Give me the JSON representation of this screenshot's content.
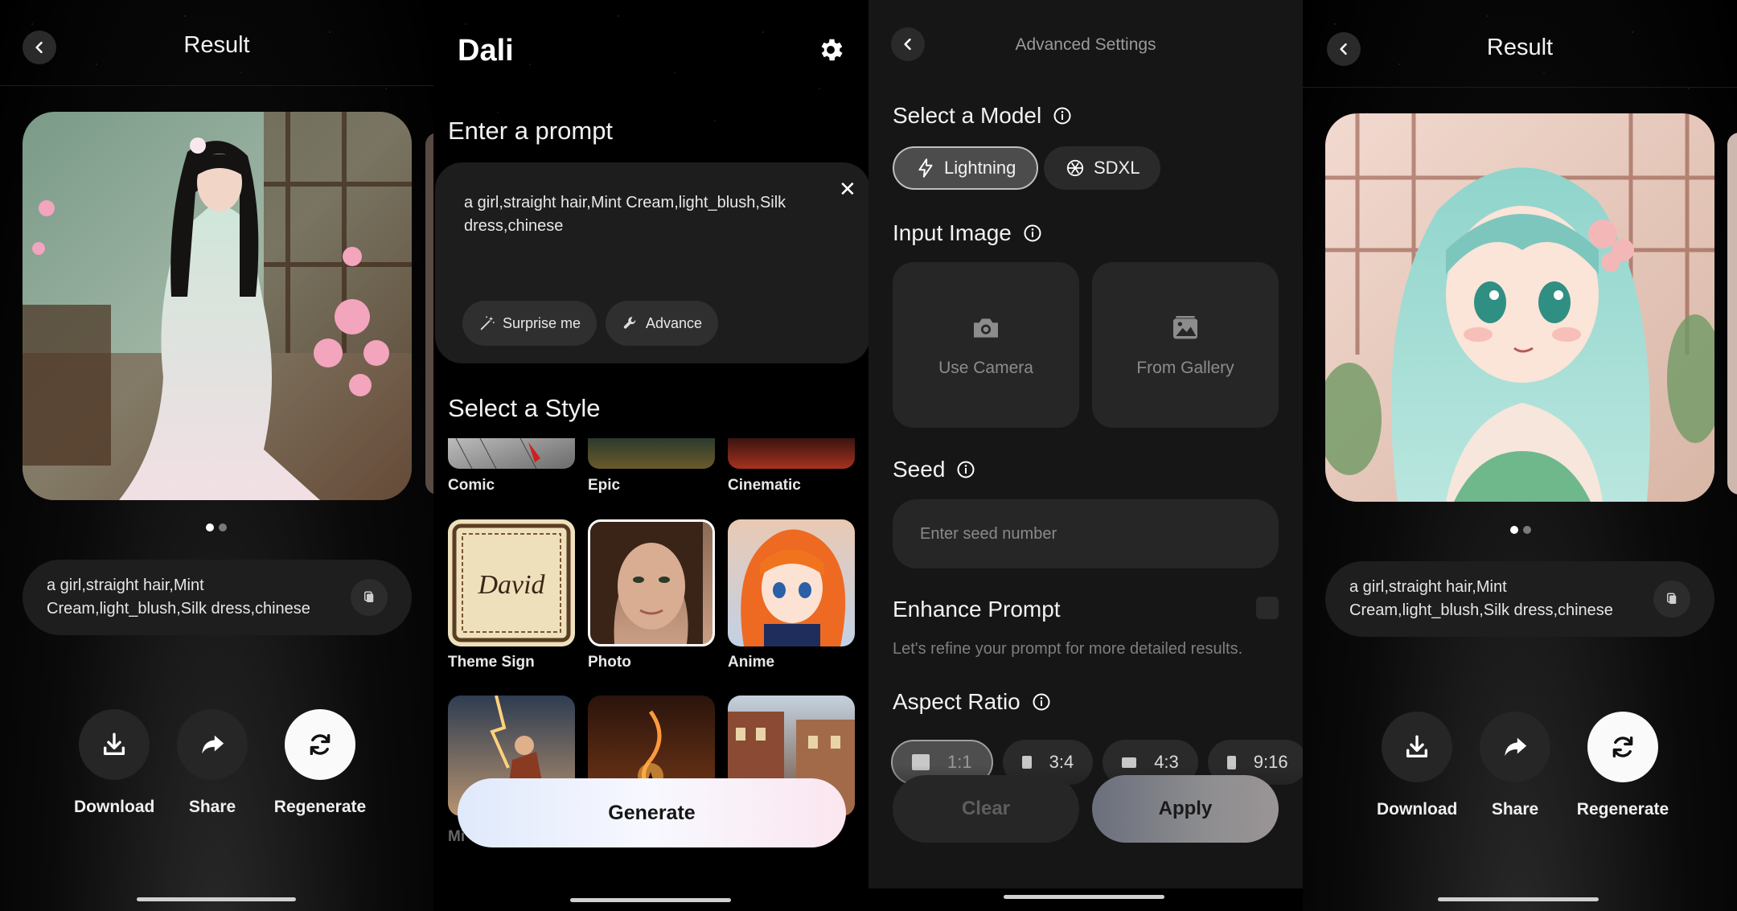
{
  "result_left": {
    "title": "Result",
    "prompt": "a girl,straight hair,Mint Cream,light_blush,Silk dress,chinese",
    "actions": {
      "download": "Download",
      "share": "Share",
      "regenerate": "Regenerate"
    },
    "carousel": {
      "pages": 2,
      "current": 1
    }
  },
  "dali": {
    "app_title": "Dali",
    "prompt_heading": "Enter a prompt",
    "prompt_value": "a girl,straight hair,Mint Cream,light_blush,Silk dress,chinese",
    "surprise_label": "Surprise me",
    "advance_label": "Advance",
    "style_heading": "Select a Style",
    "styles": [
      "Comic",
      "Epic",
      "Cinematic",
      "Theme Sign",
      "Photo",
      "Anime",
      "Mythology",
      "",
      ""
    ],
    "style_partial": "Mi",
    "generate_label": "Generate"
  },
  "advanced": {
    "title": "Advanced Settings",
    "model_heading": "Select a Model",
    "models": [
      {
        "label": "Lightning",
        "selected": true
      },
      {
        "label": "SDXL",
        "selected": false
      }
    ],
    "input_heading": "Input Image",
    "camera_label": "Use Camera",
    "gallery_label": "From Gallery",
    "seed_heading": "Seed",
    "seed_placeholder": "Enter seed number",
    "enhance_heading": "Enhance Prompt",
    "enhance_hint": "Let's refine your prompt for more detailed results.",
    "ratio_heading": "Aspect Ratio",
    "ratios": [
      "1:1",
      "3:4",
      "4:3",
      "9:16"
    ],
    "selected_ratio": "1:1",
    "clear_label": "Clear",
    "apply_label": "Apply"
  },
  "result_right": {
    "title": "Result",
    "prompt": "a girl,straight hair,Mint Cream,light_blush,Silk dress,chinese",
    "actions": {
      "download": "Download",
      "share": "Share",
      "regenerate": "Regenerate"
    },
    "carousel": {
      "pages": 2,
      "current": 1
    }
  },
  "colors": {
    "background": "#000000",
    "card": "#1e1e1e",
    "accent_button": "#fafafa",
    "generate_gradient": [
      "#dfe9fb",
      "#fbe6ef"
    ]
  }
}
